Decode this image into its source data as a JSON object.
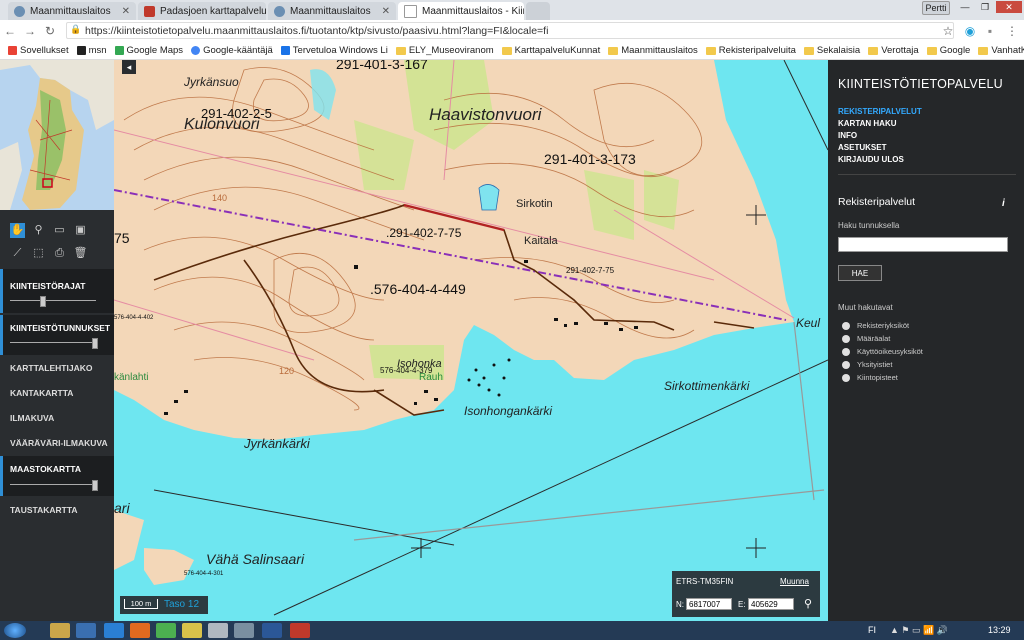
{
  "browser": {
    "tabs": [
      {
        "title": "Maanmittauslaitos",
        "active": false
      },
      {
        "title": "Padasjoen karttapalvelu",
        "active": false
      },
      {
        "title": "Maanmittauslaitos",
        "active": false
      },
      {
        "title": "Maanmittauslaitos - Kiint",
        "active": true
      }
    ],
    "user": "Pertti",
    "url": "https://kiinteistotietopalvelu.maanmittauslaitos.fi/tuotanto/ktp/sivusto/paasivu.html?lang=FI&locale=fi",
    "bookmarks": [
      "Sovellukset",
      "msn",
      "Google Maps",
      "Google-kääntäjä",
      "Tervetuloa Windows Li",
      "ELY_Museoviranom",
      "KarttapalveluKunnat",
      "Maanmittauslaitos",
      "Rekisteripalveluita",
      "Sekalaisia",
      "Verottaja",
      "Google",
      "VanhatKartat"
    ]
  },
  "left_panel": {
    "layers": [
      {
        "label": "KIINTEISTÖRAJAT",
        "active": true,
        "slider": 0.35
      },
      {
        "label": "KIINTEISTÖTUNNUKSET",
        "active": true,
        "slider": 0.98
      },
      {
        "label": "KARTTALEHTIJAKO",
        "active": false
      },
      {
        "label": "KANTAKARTTA",
        "active": false
      },
      {
        "label": "ILMAKUVA",
        "active": false
      },
      {
        "label": "VÄÄRÄVÄRI-ILMAKUVA",
        "active": false
      },
      {
        "label": "MAASTOKARTTA",
        "active": true,
        "slider": 0.98
      },
      {
        "label": "TAUSTAKARTTA",
        "active": false
      }
    ]
  },
  "map": {
    "places": {
      "jyrkansuo": "Jyrkänsuo",
      "kulonvuori": "Kulonvuori",
      "haavistonvuori": "Haavistonvuori",
      "sirkotin": "Sirkotin",
      "kaitala": "Kaitala",
      "isohonka": "Isohonka",
      "rauh": "Rauh",
      "isonhongankarki": "Isonhongankärki",
      "sirkottimenkarki": "Sirkottimenkärki",
      "jyrkankarki": "Jyrkänkärki",
      "vaha_salinsaari": "Vähä Salinsaari",
      "keul": "Keul",
      "kanlahti": "känlahti",
      "ari": "ari"
    },
    "parcels": {
      "p1": "291-401-3-167",
      "p2": "291-402-2-5",
      "p3": "291-401-3-173",
      "p4": ".291-402-7-75",
      "p5": "291-402-7-75",
      "p6": ".576-404-4-449",
      "p7": "576-404-4-379",
      "p8": "75",
      "p9": "576-404-4-402",
      "p10": "576-404-4-301"
    },
    "contour_labels": {
      "c140": "140",
      "c120": "120"
    },
    "scale_label": "100 m",
    "zoom_label": "Taso 12",
    "coords": {
      "system": "ETRS-TM35FIN",
      "change_link": "Muunna",
      "n_label": "N:",
      "n_value": "6817007",
      "e_label": "E:",
      "e_value": "405629"
    }
  },
  "right_panel": {
    "title": "KIINTEISTÖTIETOPALVELU",
    "menu": [
      "REKISTERIPALVELUT",
      "KARTAN HAKU",
      "INFO",
      "ASETUKSET",
      "KIRJAUDU ULOS"
    ],
    "section_title": "Rekisteripalvelut",
    "info_icon": "i",
    "search_label": "Haku tunnuksella",
    "search_value": "",
    "search_button": "HAE",
    "other_label": "Muut hakutavat",
    "radios": [
      "Rekisteriyksiköt",
      "Määräalat",
      "Käyttöoikeusyksiköt",
      "Yksityistiet",
      "Kiintopisteet"
    ]
  },
  "taskbar": {
    "lang": "FI",
    "time": "13:29"
  }
}
